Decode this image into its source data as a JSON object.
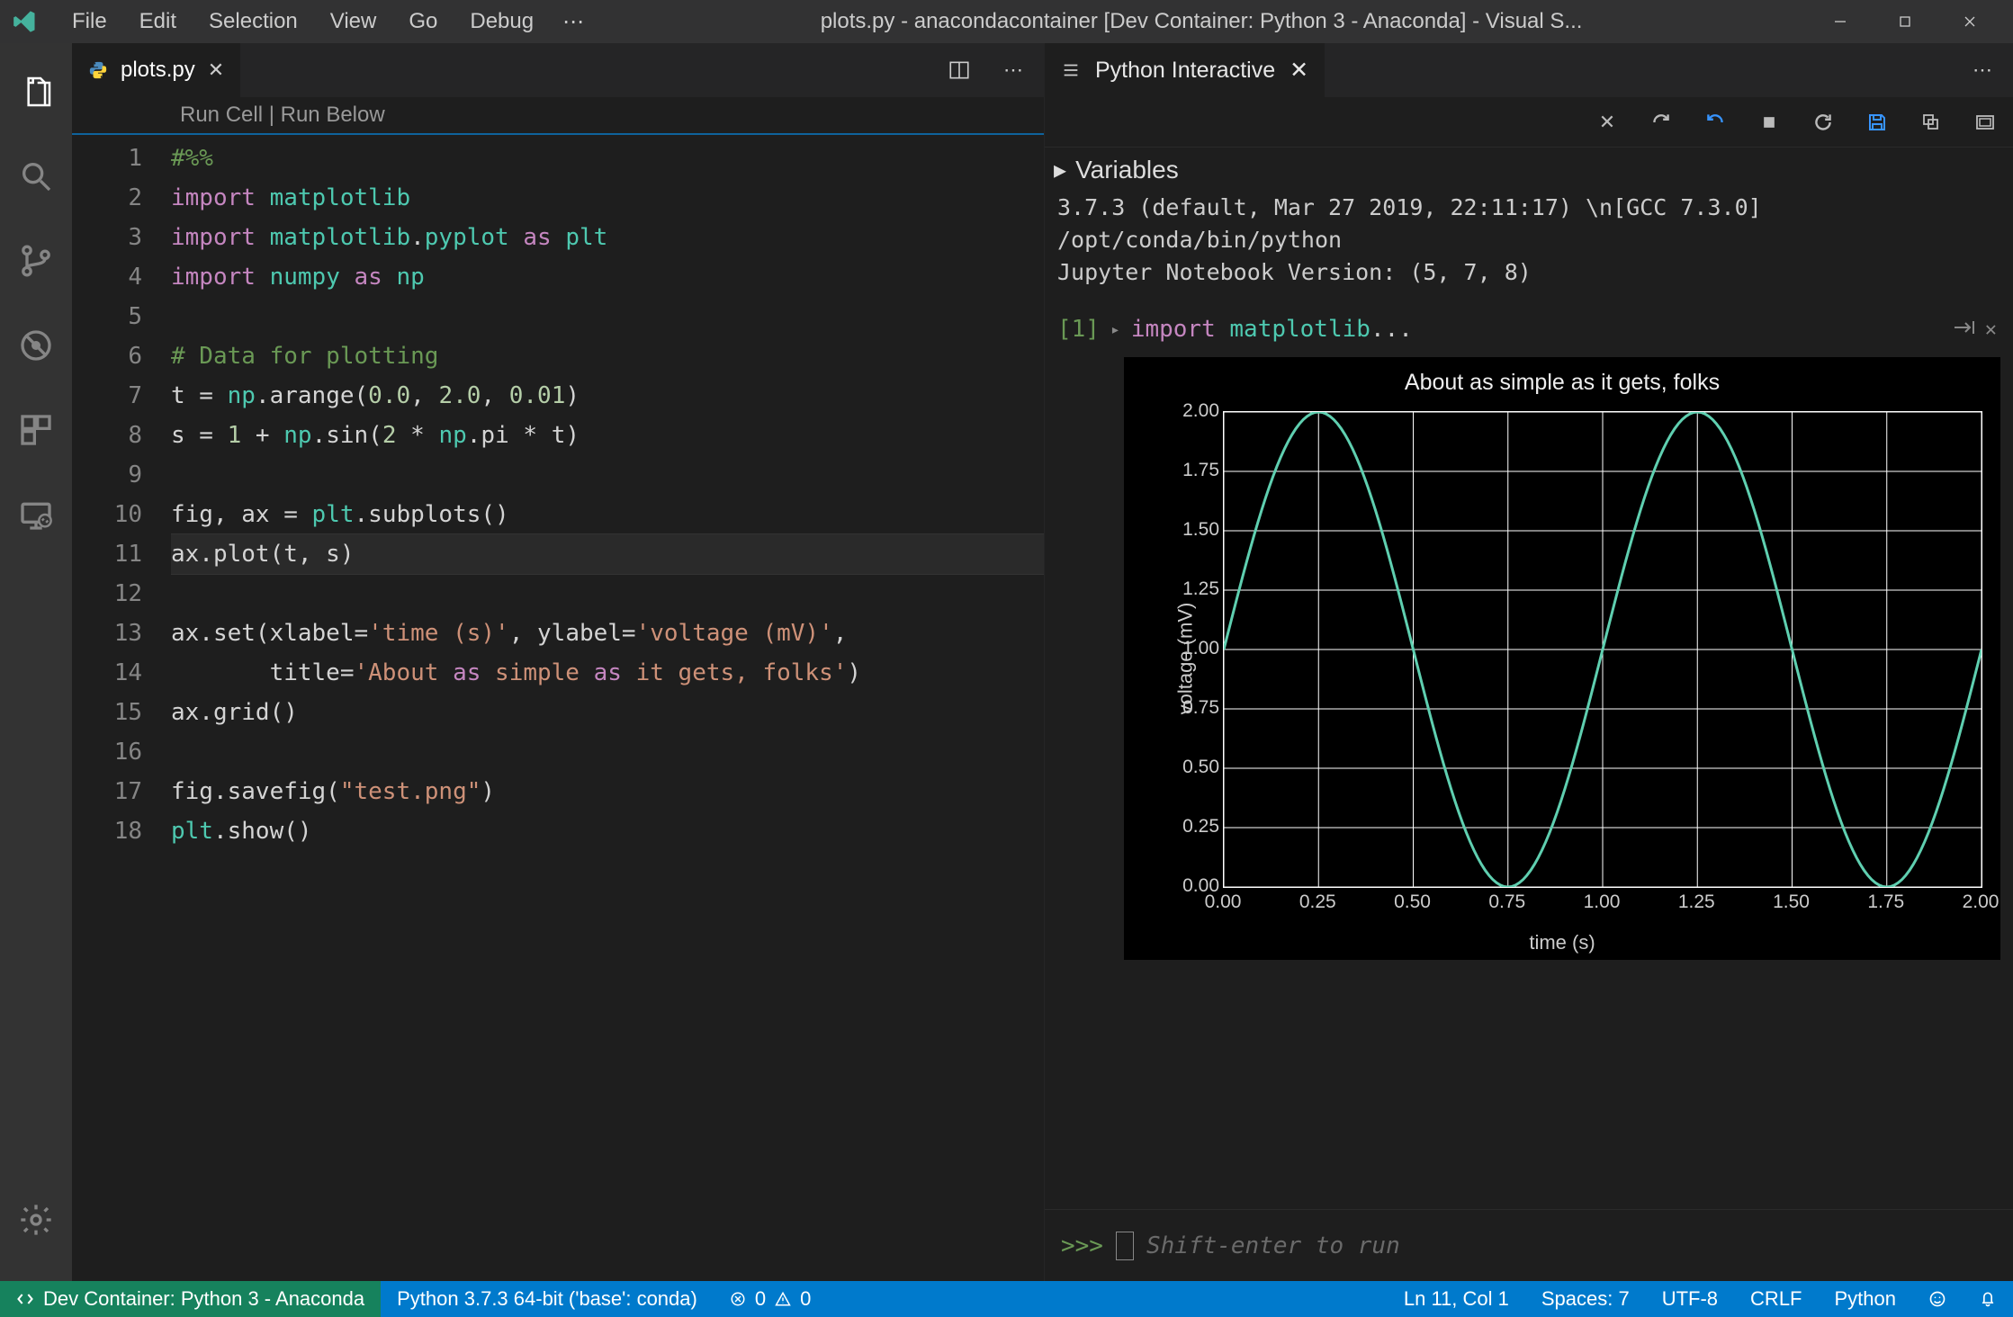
{
  "menu": {
    "file": "File",
    "edit": "Edit",
    "selection": "Selection",
    "view": "View",
    "go": "Go",
    "debug": "Debug"
  },
  "window_title": "plots.py - anacondacontainer [Dev Container: Python 3 - Anaconda] - Visual S...",
  "tabs": {
    "editor_tab": "plots.py",
    "interactive_tab": "Python Interactive"
  },
  "codelens": {
    "run_cell": "Run Cell",
    "run_below": "Run Below"
  },
  "code_lines": [
    "#%%",
    "import matplotlib",
    "import matplotlib.pyplot as plt",
    "import numpy as np",
    "",
    "# Data for plotting",
    "t = np.arange(0.0, 2.0, 0.01)",
    "s = 1 + np.sin(2 * np.pi * t)",
    "",
    "fig, ax = plt.subplots()",
    "ax.plot(t, s)",
    "",
    "ax.set(xlabel='time (s)', ylabel='voltage (mV)',",
    "       title='About as simple as it gets, folks')",
    "ax.grid()",
    "",
    "fig.savefig(\"test.png\")",
    "plt.show()"
  ],
  "interactive": {
    "variables_label": "Variables",
    "info_line1": "3.7.3 (default, Mar 27 2019, 22:11:17) \\n[GCC 7.3.0]",
    "info_line2": "/opt/conda/bin/python",
    "info_line3": "Jupyter Notebook Version: (5, 7, 8)",
    "cell_num": "[1]",
    "cell_code_kw": "import",
    "cell_code_id": "matplotlib",
    "cell_code_ellipsis": "...",
    "prompt": ">>>",
    "placeholder": "Shift-enter to run"
  },
  "chart_data": {
    "type": "line",
    "title": "About as simple as it gets, folks",
    "xlabel": "time (s)",
    "ylabel": "voltage (mV)",
    "xlim": [
      0.0,
      2.0
    ],
    "ylim": [
      0.0,
      2.0
    ],
    "x_ticks": [
      0.0,
      0.25,
      0.5,
      0.75,
      1.0,
      1.25,
      1.5,
      1.75,
      2.0
    ],
    "y_ticks": [
      0.0,
      0.25,
      0.5,
      0.75,
      1.0,
      1.25,
      1.5,
      1.75,
      2.0
    ],
    "series": [
      {
        "name": "s",
        "formula": "1 + sin(2*pi*t)",
        "x_range": [
          0.0,
          2.0
        ],
        "dx": 0.01,
        "color": "#5fcfb0"
      }
    ],
    "grid": true,
    "background": "#000000",
    "foreground": "#ffffff"
  },
  "status": {
    "remote": "Dev Container: Python 3 - Anaconda",
    "interpreter": "Python 3.7.3 64-bit ('base': conda)",
    "errors": "0",
    "warnings": "0",
    "cursor": "Ln 11, Col 1",
    "spaces": "Spaces: 7",
    "encoding": "UTF-8",
    "eol": "CRLF",
    "lang": "Python"
  }
}
